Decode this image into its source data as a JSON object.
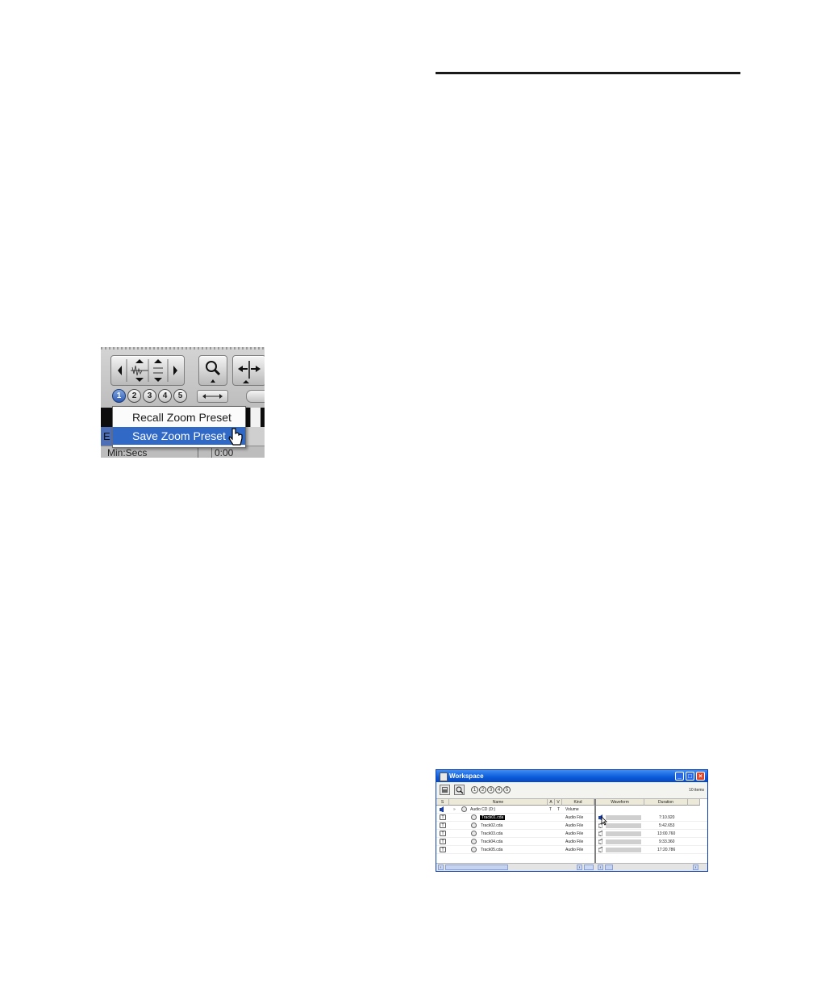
{
  "zoom_figure": {
    "preset_numbers": [
      "1",
      "2",
      "3",
      "4",
      "5"
    ],
    "menu": {
      "recall_label": "Recall Zoom Preset",
      "save_label": "Save Zoom Preset"
    },
    "left_fragment": "E",
    "ruler_label": "Min:Secs",
    "ruler_value": "0:00"
  },
  "workspace_figure": {
    "window_title": "Workspace",
    "item_count": "10 items",
    "preset_numbers": [
      "1",
      "2",
      "3",
      "4",
      "5"
    ],
    "columns": {
      "s": "S",
      "name": "Name",
      "a": "A",
      "v": "V",
      "kind": "Kind",
      "waveform": "Waveform",
      "duration": "Duration"
    },
    "volume_row": {
      "name": "Audio CD (D:)",
      "a": "T",
      "v": "T",
      "kind": "Volume"
    },
    "files": [
      {
        "s": "T",
        "name": "Track01.cda",
        "kind": "Audio File",
        "duration": "7:10.920"
      },
      {
        "s": "T",
        "name": "Track02.cda",
        "kind": "Audio File",
        "duration": "5:42.653"
      },
      {
        "s": "T",
        "name": "Track03.cda",
        "kind": "Audio File",
        "duration": "13:00.760"
      },
      {
        "s": "T",
        "name": "Track04.cda",
        "kind": "Audio File",
        "duration": "9:33.360"
      },
      {
        "s": "T",
        "name": "Track05.cda",
        "kind": "Audio File",
        "duration": "17:20.786"
      }
    ]
  }
}
